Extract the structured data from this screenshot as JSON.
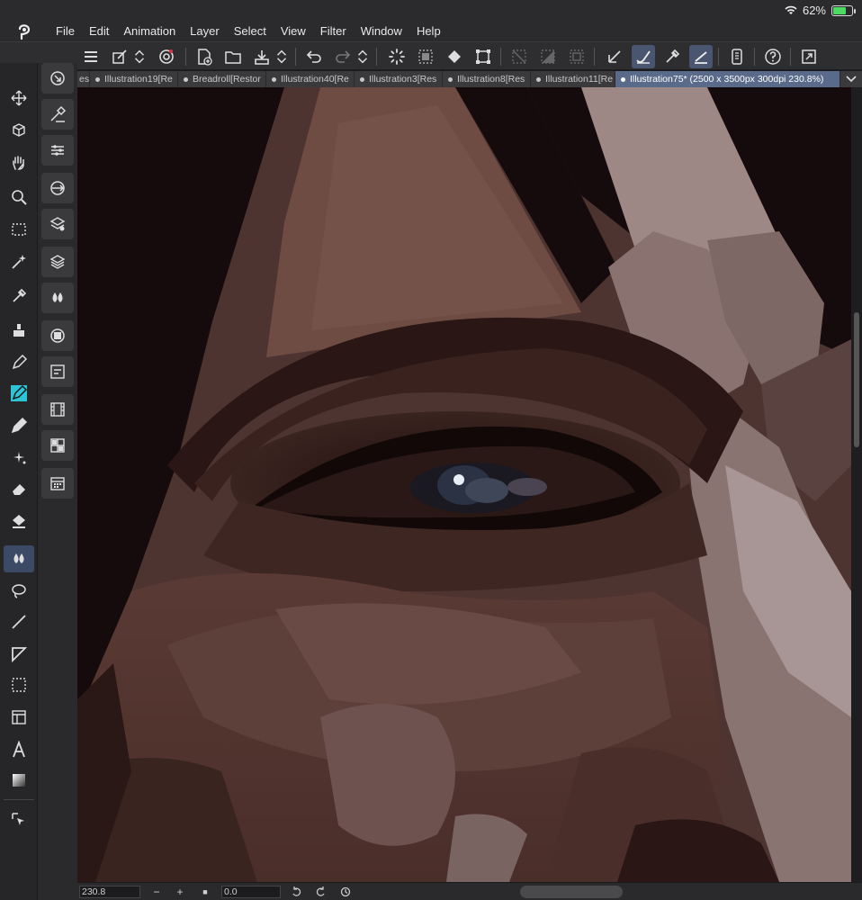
{
  "status": {
    "battery": "62%",
    "battery_level": 0.62
  },
  "menu": [
    "File",
    "Edit",
    "Animation",
    "Layer",
    "Select",
    "View",
    "Filter",
    "Window",
    "Help"
  ],
  "tabs": [
    {
      "label": "es"
    },
    {
      "label": "Illustration19[Re"
    },
    {
      "label": "Breadroll[Restor"
    },
    {
      "label": "Illustration40[Re"
    },
    {
      "label": "Illustration3[Res"
    },
    {
      "label": "Illustration8[Res"
    },
    {
      "label": "Illustration11[Re"
    },
    {
      "label": "Illustration75* (2500 x 3500px 300dpi 230.8%)"
    }
  ],
  "panel_head": {
    "left": "«",
    "right": "»"
  },
  "bottom": {
    "zoom": "230.8",
    "rotation": "0.0",
    "minus": "−",
    "plus": "+",
    "stop": "■"
  },
  "colors": {
    "main": "#6e4a40",
    "sub": "#1a1040",
    "accent": "#5a6a8a"
  }
}
